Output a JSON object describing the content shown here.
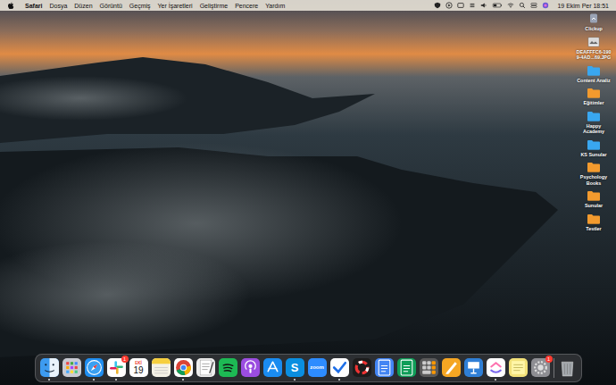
{
  "menu_bar": {
    "app": "Safari",
    "menus": [
      "Dosya",
      "Düzen",
      "Görüntü",
      "Geçmiş",
      "Yer İşaretleri",
      "Geliştirme",
      "Pencere",
      "Yardım"
    ],
    "clock": "19 Ekim Per  18:51"
  },
  "desktop_items": [
    {
      "lines": [
        "Clickup"
      ],
      "kind": "app",
      "color": "#9aa3b5"
    },
    {
      "lines": [
        "DEAFFFC6-190",
        "9-4AD...69.JPG"
      ],
      "kind": "file",
      "color": "#d9d9d9"
    },
    {
      "lines": [
        "Content Analiz"
      ],
      "kind": "folder",
      "color": "#3aa7f0"
    },
    {
      "lines": [
        "Eğitimler"
      ],
      "kind": "folder",
      "color": "#f29a2e"
    },
    {
      "lines": [
        "Happy",
        "Academy"
      ],
      "kind": "folder",
      "color": "#3aa7f0"
    },
    {
      "lines": [
        "KS Sunular"
      ],
      "kind": "folder",
      "color": "#3aa7f0"
    },
    {
      "lines": [
        "Psychology",
        "Books"
      ],
      "kind": "folder",
      "color": "#f29a2e"
    },
    {
      "lines": [
        "Sunular"
      ],
      "kind": "folder",
      "color": "#f29a2e"
    },
    {
      "lines": [
        "Testler"
      ],
      "kind": "folder",
      "color": "#f29a2e"
    }
  ],
  "dock": [
    {
      "kind": "finder",
      "color": "#3d9bf0",
      "running": true
    },
    {
      "kind": "launchpad",
      "color": "#c9cbd3",
      "running": false
    },
    {
      "kind": "safari",
      "color": "#1f8ef1",
      "running": true
    },
    {
      "kind": "slack",
      "color": "#ffffff",
      "running": true,
      "badge": "1"
    },
    {
      "kind": "calendar",
      "color": "#ffffff",
      "running": false,
      "top": "EKİ",
      "text": "19"
    },
    {
      "kind": "notes",
      "color": "#f4f1e6",
      "running": false
    },
    {
      "kind": "chrome",
      "color": "#ffffff",
      "running": true
    },
    {
      "kind": "textedit",
      "color": "#eeeeee",
      "running": false
    },
    {
      "kind": "spotify",
      "color": "#1db954",
      "running": false
    },
    {
      "kind": "podcasts",
      "color": "#9b4de0",
      "running": false
    },
    {
      "kind": "appstore",
      "color": "#1a8cf0",
      "running": false
    },
    {
      "kind": "skype",
      "color": "#0a8ee0",
      "running": true,
      "text": "S"
    },
    {
      "kind": "zoom",
      "color": "#2d8cff",
      "running": false,
      "text": "zoom"
    },
    {
      "kind": "tasks",
      "color": "#ffffff",
      "running": true
    },
    {
      "kind": "ring",
      "color": "#1c1c1c",
      "running": false
    },
    {
      "kind": "docs",
      "color": "#4285f4",
      "running": false
    },
    {
      "kind": "sheets",
      "color": "#0f9d58",
      "running": false
    },
    {
      "kind": "calculator",
      "color": "#5a5a5a",
      "running": false
    },
    {
      "kind": "pages",
      "color": "#f5a623",
      "running": false
    },
    {
      "kind": "keynote",
      "color": "#2f7fd6",
      "running": false
    },
    {
      "kind": "clickup",
      "color": "#ffffff",
      "running": true
    },
    {
      "kind": "stickies",
      "color": "#f3e27a",
      "running": false
    },
    {
      "kind": "settings",
      "color": "#8e8e93",
      "running": false,
      "badge": "1"
    }
  ],
  "trash": {
    "kind": "trash",
    "color": "#a3a8ad",
    "running": false
  }
}
